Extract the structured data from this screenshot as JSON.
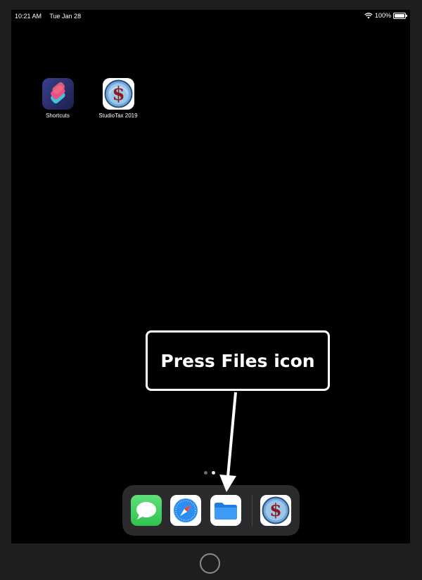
{
  "status_bar": {
    "time": "10:21 AM",
    "date": "Tue Jan 28",
    "battery_text": "100%",
    "battery_level": 1.0,
    "wifi_icon": "wifi-icon"
  },
  "home_screen": {
    "apps": [
      {
        "label": "Shortcuts",
        "icon": "shortcuts-icon"
      },
      {
        "label": "StudioTax 2019",
        "icon": "studiotax-icon"
      }
    ]
  },
  "callout": {
    "text": "Press Files icon"
  },
  "page_indicator": {
    "pages": 2,
    "active": 2
  },
  "dock": {
    "apps": [
      {
        "name": "Messages",
        "icon": "messages-icon"
      },
      {
        "name": "Safari",
        "icon": "safari-icon"
      },
      {
        "name": "Files",
        "icon": "files-icon"
      },
      {
        "name": "StudioTax 2019",
        "icon": "studiotax-icon"
      }
    ]
  },
  "colors": {
    "messages_green": "#34c759",
    "safari_blue": "#1e88e5",
    "files_blue": "#2f8cf0",
    "studiotax_red": "#9c1b1b",
    "bezel": "#1e1e20",
    "dock": "#2b2b2d"
  }
}
